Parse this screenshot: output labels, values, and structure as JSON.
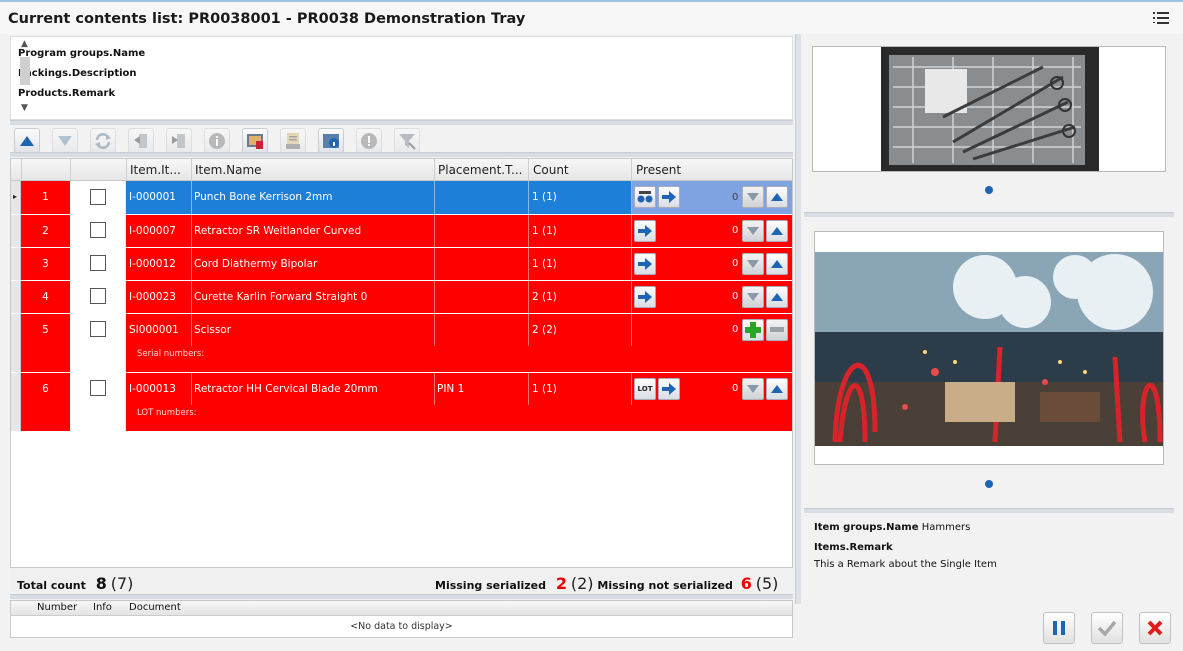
{
  "window": {
    "title": "Current contents list: PR0038001 - PR0038 Demonstration Tray"
  },
  "fields": [
    "Program groups.Name",
    "Packings.Description",
    "Products.Remark"
  ],
  "toolbar": [
    "arrow-up-icon",
    "arrow-down-icon",
    "refresh-icon",
    "move-out-icon",
    "move-in-icon",
    "info-icon",
    "image-icon",
    "document-icon",
    "details-icon",
    "warning-icon",
    "filter-clear-icon"
  ],
  "columns": {
    "item": "Item.It...",
    "name": "Item.Name",
    "placement": "Placement.T...",
    "count": "Count",
    "present": "Present"
  },
  "rows": [
    {
      "num": "1",
      "item": "I-000001",
      "name": "Punch Bone Kerrison 2mm",
      "placement": "",
      "count": "1 (1)",
      "present": "0",
      "selected": true
    },
    {
      "num": "2",
      "item": "I-000007",
      "name": "Retractor SR Weitlander Curved",
      "placement": "",
      "count": "1 (1)",
      "present": "0"
    },
    {
      "num": "3",
      "item": "I-000012",
      "name": "Cord Diathermy Bipolar",
      "placement": "",
      "count": "1 (1)",
      "present": "0"
    },
    {
      "num": "4",
      "item": "I-000023",
      "name": "Curette Karlin Forward Straight 0",
      "placement": "",
      "count": "2 (1)",
      "present": "0"
    },
    {
      "num": "5",
      "item": "SI000001",
      "name": "Scissor",
      "placement": "",
      "count": "2 (2)",
      "present": "0",
      "sub": "Serial numbers:"
    },
    {
      "num": "6",
      "item": "I-000013",
      "name": "Retractor HH Cervical Blade 20mm",
      "placement": "PIN 1",
      "count": "1 (1)",
      "present": "0",
      "sub": "LOT numbers:"
    }
  ],
  "totals": {
    "total_label": "Total count",
    "total_value": "8",
    "total_paren": "(7)",
    "ms_label": "Missing serialized",
    "ms_value": "2",
    "ms_paren": "(2)",
    "mns_label": "Missing not serialized",
    "mns_value": "6",
    "mns_paren": "(5)"
  },
  "documents": {
    "col_number": "Number",
    "col_info": "Info",
    "col_document": "Document",
    "empty": "<No data to display>"
  },
  "details": {
    "group_label": "Item groups.Name",
    "group_value": "Hammers",
    "remark_label": "Items.Remark",
    "remark_value": "This a Remark about the Single Item"
  },
  "lot_label": "LOT",
  "colors": {
    "row_red": "#ff0000",
    "selected_blue": "#1e7fd8",
    "accent_blue": "#1e64b4"
  }
}
